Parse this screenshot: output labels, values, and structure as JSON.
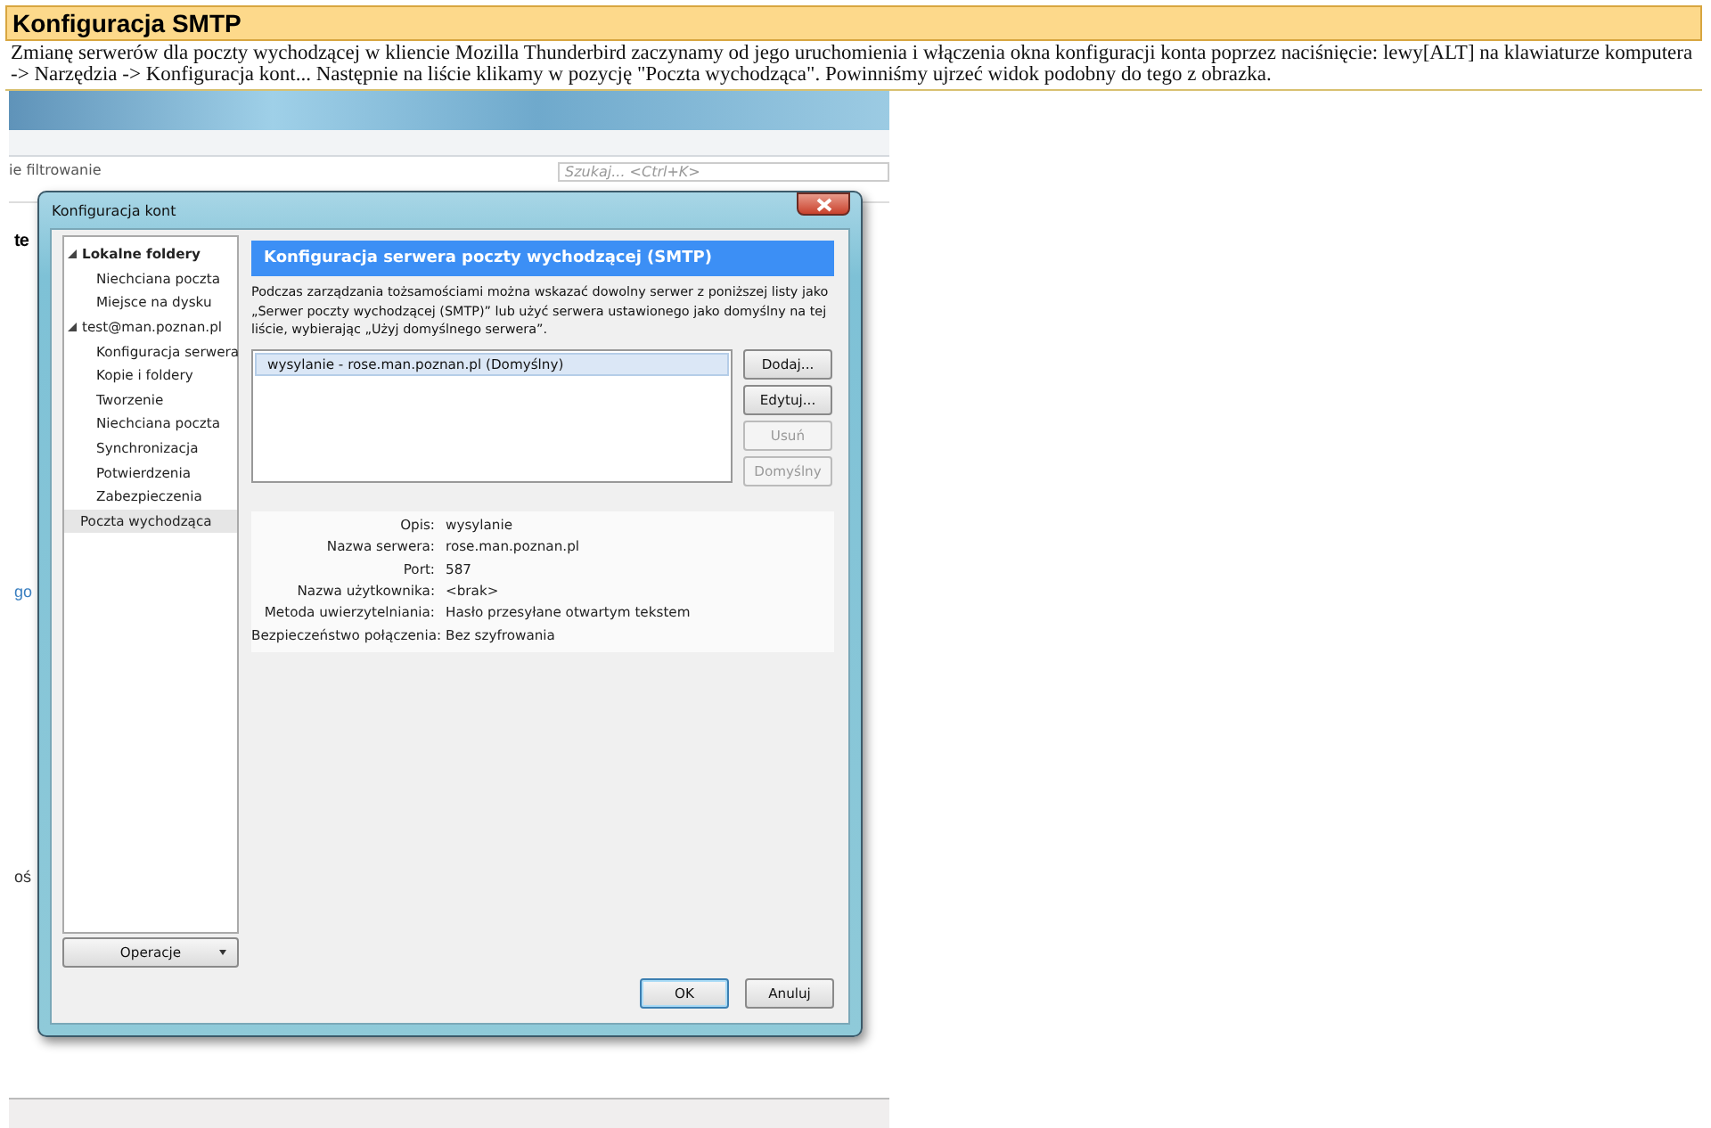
{
  "heading": "Konfiguracja SMTP",
  "intro": "Zmianę serwerów dla poczty wychodzącej w kliencie Mozilla Thunderbird zaczynamy od jego uruchomienia i włączenia okna konfiguracji konta poprzez naciśnięcie: lewy[ALT] na klawiaturze komputera -> Narzędzia -> Konfiguracja kont... Następnie na liście klikamy w pozycję \"Poczta wychodząca\". Powinniśmy ujrzeć widok podobny do tego z obrazka.",
  "screenshot": {
    "background_app": {
      "filter_label": "ie filtrowanie",
      "search": {
        "placeholder": "Szukaj... <Ctrl+K>"
      },
      "fragments": [
        {
          "kind": "heading",
          "text": "te"
        },
        {
          "kind": "link",
          "text": "go"
        },
        {
          "kind": "text",
          "text": "oś"
        }
      ]
    },
    "dialog": {
      "title": "Konfiguracja kont",
      "tree": [
        {
          "label": "Lokalne foldery",
          "expanded": true,
          "selected": false,
          "children": [
            {
              "label": "Niechciana poczta",
              "selected": false
            },
            {
              "label": "Miejsce na dysku",
              "selected": false
            }
          ]
        },
        {
          "label": "test@man.poznan.pl",
          "expanded": true,
          "selected": false,
          "children": [
            {
              "label": "Konfiguracja serwera",
              "selected": false
            },
            {
              "label": "Kopie i foldery",
              "selected": false
            },
            {
              "label": "Tworzenie",
              "selected": false
            },
            {
              "label": "Niechciana poczta",
              "selected": false
            },
            {
              "label": "Synchronizacja",
              "selected": false
            },
            {
              "label": "Potwierdzenia",
              "selected": false
            },
            {
              "label": "Zabezpieczenia",
              "selected": false
            }
          ]
        },
        {
          "label": "Poczta wychodząca",
          "selected": true
        }
      ],
      "operations_button": "Operacje",
      "panel_title": "Konfiguracja serwera poczty wychodzącej (SMTP)",
      "description": "Podczas zarządzania tożsamościami można wskazać dowolny serwer z poniższej listy jako „Serwer poczty wychodzącej (SMTP)” lub użyć serwera ustawionego jako domyślny na tej liście, wybierając „Użyj domyślnego serwera”.",
      "servers": [
        {
          "label": "wysylanie - rose.man.poznan.pl (Domyślny)",
          "selected": true
        }
      ],
      "server_buttons": [
        {
          "label": "Dodaj...",
          "disabled": false
        },
        {
          "label": "Edytuj...",
          "disabled": false
        },
        {
          "label": "Usuń",
          "disabled": true
        },
        {
          "label": "Domyślny",
          "disabled": true
        }
      ],
      "details": [
        {
          "label": "Opis:",
          "value": "wysylanie"
        },
        {
          "label": "Nazwa serwera:",
          "value": "rose.man.poznan.pl"
        },
        {
          "label": "Port:",
          "value": "587"
        },
        {
          "label": "Nazwa użytkownika:",
          "value": "<brak>"
        },
        {
          "label": "Metoda uwierzytelniania:",
          "value": "Hasło przesyłane otwartym tekstem"
        },
        {
          "label": "Bezpieczeństwo połączenia:",
          "value": "Bez szyfrowania"
        }
      ],
      "footer_buttons": [
        {
          "label": "OK",
          "default": true
        },
        {
          "label": "Anuluj",
          "default": false
        }
      ]
    }
  }
}
